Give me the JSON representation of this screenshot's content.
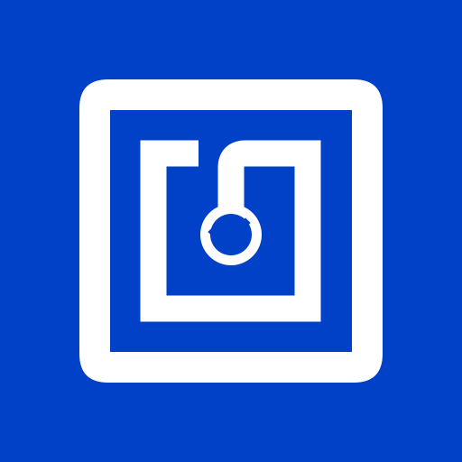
{
  "icon": {
    "name": "nfc-tag-check-icon",
    "background_color": "#0041C8",
    "foreground_color": "#FFFFFF"
  }
}
